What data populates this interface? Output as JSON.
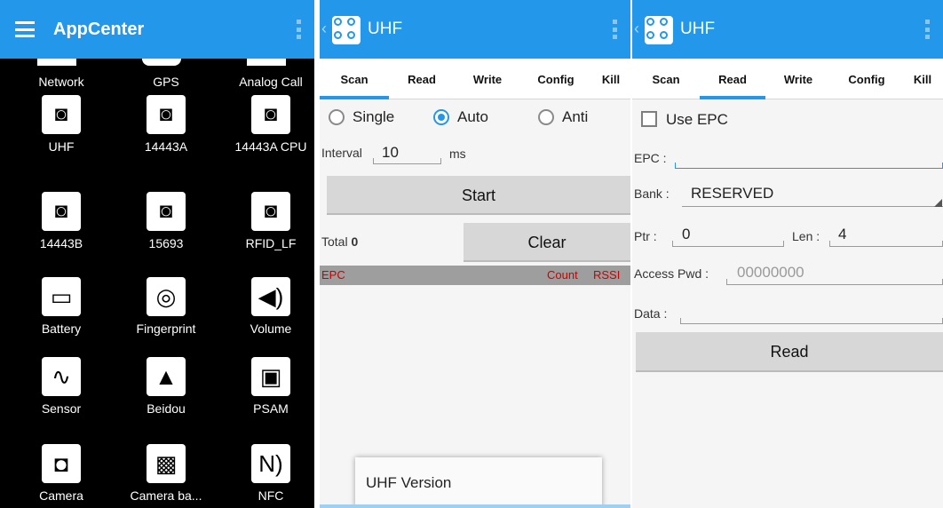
{
  "launcher": {
    "title": "AppCenter",
    "apps": [
      {
        "label": "Network",
        "icon": "network-icon"
      },
      {
        "label": "GPS",
        "icon": "gps-icon"
      },
      {
        "label": "Analog Call",
        "icon": "phone-icon"
      },
      {
        "label": "UHF",
        "icon": "rfid-tag-icon",
        "glyph": "◙"
      },
      {
        "label": "14443A",
        "icon": "rfid-tag-icon",
        "glyph": "◙"
      },
      {
        "label": "14443A CPU",
        "icon": "rfid-tag-icon",
        "glyph": "◙"
      },
      {
        "label": "14443B",
        "icon": "rfid-tag-icon",
        "glyph": "◙"
      },
      {
        "label": "15693",
        "icon": "rfid-tag-icon",
        "glyph": "◙"
      },
      {
        "label": "RFID_LF",
        "icon": "rfid-tag-icon",
        "glyph": "◙"
      },
      {
        "label": "Battery",
        "icon": "battery-icon",
        "glyph": "▭"
      },
      {
        "label": "Fingerprint",
        "icon": "fingerprint-icon",
        "glyph": "◎"
      },
      {
        "label": "Volume",
        "icon": "volume-icon",
        "glyph": "◀)"
      },
      {
        "label": "Sensor",
        "icon": "sensor-pulse-icon",
        "glyph": "∿"
      },
      {
        "label": "Beidou",
        "icon": "navigation-arrow-icon",
        "glyph": "▲"
      },
      {
        "label": "PSAM",
        "icon": "sim-card-icon",
        "glyph": "▣"
      },
      {
        "label": "Camera",
        "icon": "camera-icon",
        "glyph": "◘"
      },
      {
        "label": "Camera ba...",
        "icon": "barcode-camera-icon",
        "glyph": "▩"
      },
      {
        "label": "NFC",
        "icon": "nfc-icon",
        "glyph": "N)"
      }
    ]
  },
  "scan_screen": {
    "title": "UHF",
    "tabs": [
      "Scan",
      "Read",
      "Write",
      "Config",
      "Kill"
    ],
    "active_tab": "Scan",
    "modes": [
      {
        "label": "Single",
        "selected": false
      },
      {
        "label": "Auto",
        "selected": true
      },
      {
        "label": "Anti",
        "selected": false
      }
    ],
    "interval_label": "Interval",
    "interval_value": "10",
    "interval_unit": "ms",
    "start_label": "Start",
    "total_label": "Total",
    "total_value": "0",
    "clear_label": "Clear",
    "columns": {
      "epc": "EPC",
      "count": "Count",
      "rssi": "RSSI"
    },
    "menu_item": "UHF Version"
  },
  "read_screen": {
    "title": "UHF",
    "tabs": [
      "Scan",
      "Read",
      "Write",
      "Config",
      "Kill"
    ],
    "active_tab": "Read",
    "use_epc_label": "Use EPC",
    "use_epc_checked": false,
    "epc_label": "EPC :",
    "epc_value": "",
    "bank_label": "Bank :",
    "bank_value": "RESERVED",
    "ptr_label": "Ptr :",
    "ptr_value": "0",
    "len_label": "Len :",
    "len_value": "4",
    "pwd_label": "Access Pwd :",
    "pwd_placeholder": "00000000",
    "data_label": "Data :",
    "data_value": "",
    "read_button": "Read"
  },
  "colors": {
    "accent": "#2397e9",
    "header_row": "#9e9e9e",
    "header_text": "#cc0000"
  }
}
